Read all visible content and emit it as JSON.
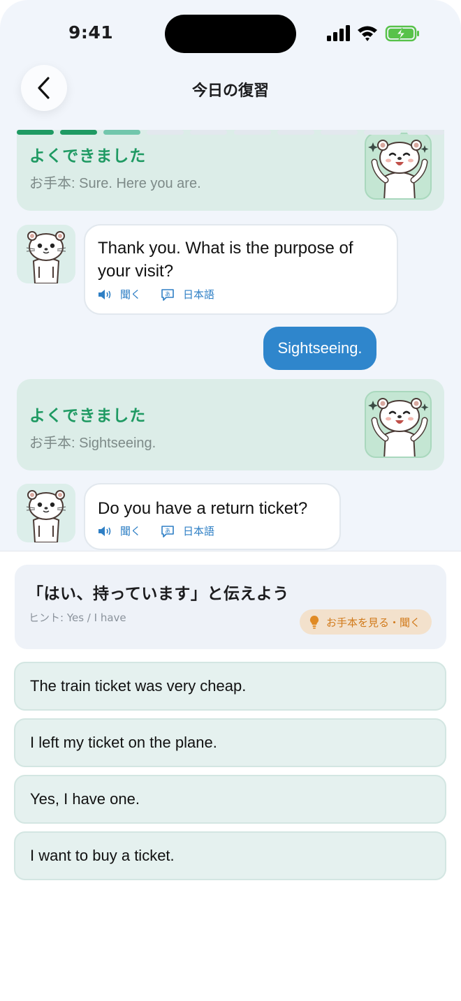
{
  "status_bar": {
    "time": "9:41"
  },
  "header": {
    "title": "今日の復習",
    "back_icon": "chevron-left-icon"
  },
  "progress": {
    "segments_total": 10,
    "segments_done": 2,
    "segments_current": 1,
    "colors": {
      "done": "#1f9a63",
      "current": "#72c6ac",
      "todo": "#e3e8ee"
    }
  },
  "chat": {
    "feedback_1": {
      "title": "よくできました",
      "model": "お手本: Sure. Here you are."
    },
    "message_1": {
      "text_line1": "Thank you. What is the purpose of",
      "text_line2": "your visit?",
      "listen_label": "聞く",
      "japanese_label": "日本語"
    },
    "user_reply": "Sightseeing.",
    "feedback_2": {
      "title": "よくできました",
      "model": "お手本: Sightseeing."
    },
    "message_2": {
      "text": "Do you have a return ticket?",
      "listen_label": "聞く",
      "japanese_label": "日本語"
    }
  },
  "task": {
    "prompt": "「はい、持っています」と伝えよう",
    "hint": "ヒント: Yes / I have",
    "model_button": "お手本を見る・聞く"
  },
  "options": [
    "The train ticket was very cheap.",
    "I left my ticket on the plane.",
    "Yes, I have one.",
    "I want to buy a ticket."
  ],
  "colors": {
    "accent_green": "#1f9a63",
    "accent_blue": "#2f86cc",
    "hint_orange": "#d17a1b"
  }
}
